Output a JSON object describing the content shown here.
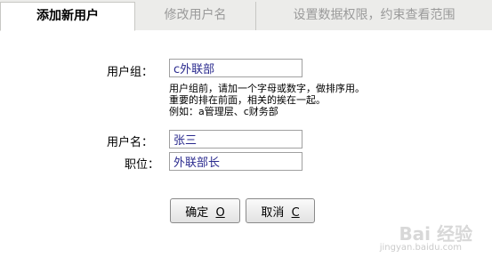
{
  "tabs": {
    "add_user": "添加新用户",
    "edit_user": "修改用户名",
    "permissions": "设置数据权限，约束查看范围"
  },
  "form": {
    "group_label": "用户组：",
    "group_value": "c外联部",
    "hint_line1": "用户组前，请加一个字母或数字，做排序用。",
    "hint_line2": "重要的排在前面，相关的挨在一起。",
    "hint_line3": "例如：a管理层、c财务部",
    "username_label": "用户名：",
    "username_value": "张三",
    "position_label": "职位：",
    "position_value": "外联部长"
  },
  "buttons": {
    "ok_label": "确定",
    "ok_key": "O",
    "cancel_label": "取消",
    "cancel_key": "C"
  },
  "watermark": {
    "brand": "Bai 经验",
    "sub": "jingyan.baidu.com"
  }
}
